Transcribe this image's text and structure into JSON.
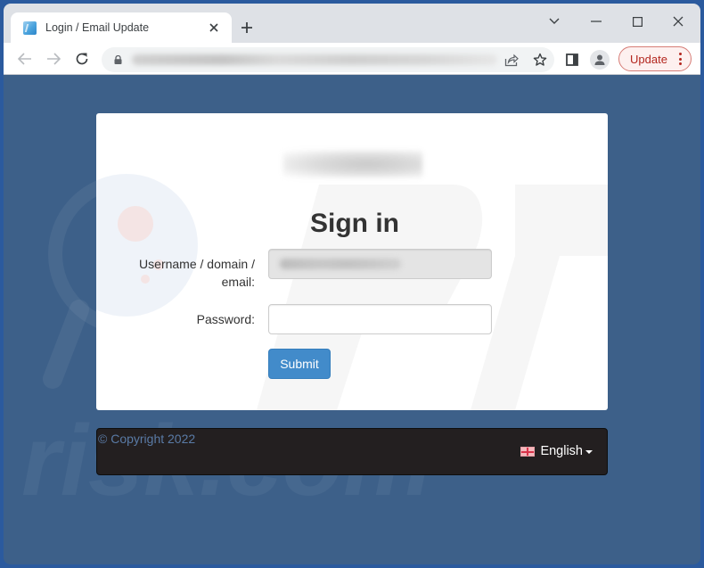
{
  "browser": {
    "tab": {
      "title": "Login / Email Update",
      "favicon": "site-favicon"
    },
    "new_tab_symbol": "+",
    "window_controls": {
      "tab_search": "chevron-down-icon",
      "minimize": "minimize-icon",
      "maximize": "maximize-icon",
      "close": "close-icon"
    },
    "toolbar": {
      "back": "back-arrow-icon",
      "forward": "forward-arrow-icon",
      "reload": "reload-icon",
      "lock": "lock-icon",
      "url": "",
      "share": "share-icon",
      "bookmark": "star-icon",
      "side_panel": "side-panel-icon",
      "profile": "profile-icon",
      "update_label": "Update",
      "menu": "kebab-menu-icon"
    }
  },
  "login": {
    "title": "Sign in",
    "username_label": "Username / domain /\nemail:",
    "username_label_line1": "Username / domain /",
    "username_label_line2": "email:",
    "username_value": "",
    "password_label": "Password:",
    "password_value": "",
    "submit_label": "Submit"
  },
  "footer": {
    "copyright": "© Copyright 2022",
    "language": "English",
    "language_flag": "flag-icon"
  },
  "colors": {
    "page_background": "#3d6089",
    "submit_button": "#428bca",
    "footer_background": "#231f20",
    "copyright_text": "#5a7ba6",
    "update_accent": "#b3261e"
  }
}
